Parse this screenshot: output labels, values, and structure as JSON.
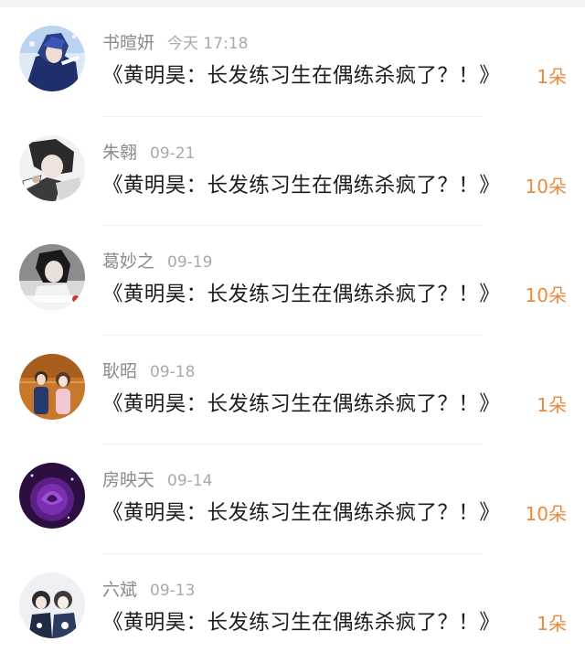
{
  "items": [
    {
      "name": "书暄妍",
      "date": "今天 17:18",
      "title": "《黄明昊：长发练习生在偶练杀疯了？！》",
      "count": "1朵",
      "avatar": "avatar-anime-boy-blue"
    },
    {
      "name": "朱翱",
      "date": "09-21",
      "title": "《黄明昊：长发练习生在偶练杀疯了？！》",
      "count": "10朵",
      "avatar": "avatar-anime-boy-sketch"
    },
    {
      "name": "葛妙之",
      "date": "09-19",
      "title": "《黄明昊：长发练习生在偶练杀疯了？！》",
      "count": "10朵",
      "avatar": "avatar-portrait-dark"
    },
    {
      "name": "耿昭",
      "date": "09-18",
      "title": "《黄明昊：长发练习生在偶练杀疯了？！》",
      "count": "1朵",
      "avatar": "avatar-couple-photo"
    },
    {
      "name": "房映天",
      "date": "09-14",
      "title": "《黄明昊：长发练习生在偶练杀疯了？！》",
      "count": "10朵",
      "avatar": "avatar-purple-rose"
    },
    {
      "name": "六斌",
      "date": "09-13",
      "title": "《黄明昊：长发练习生在偶练杀疯了？！》",
      "count": "1朵",
      "avatar": "avatar-couple-cartoon"
    }
  ],
  "colors": {
    "name": "#8a8a8a",
    "date": "#a9a9a9",
    "title": "#1c1c1c",
    "count": "#ec8a3c"
  }
}
